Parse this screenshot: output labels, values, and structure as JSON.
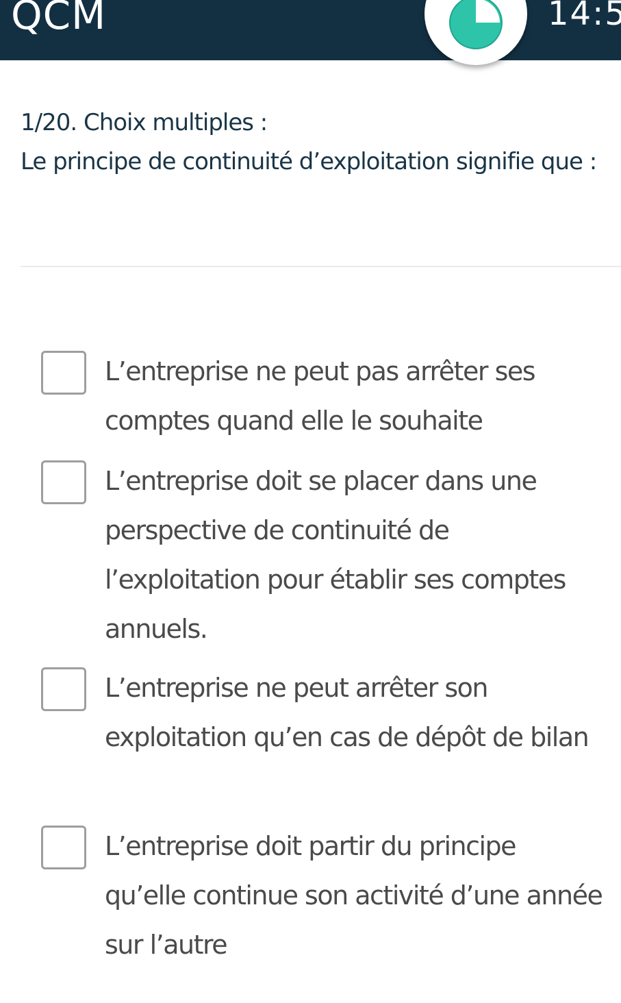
{
  "header": {
    "title": "QCM",
    "time": "14:5",
    "background_color": "#133043",
    "timer_icon": "clock-pie-icon",
    "timer_color": "#2ec4a9"
  },
  "question": {
    "number_label": "1/20. Choix multiples :",
    "text": "Le principe de continuité d’exploitation signifie que :"
  },
  "answers": [
    {
      "text": "L’entreprise ne peut pas arrêter ses comptes quand elle le souhaite",
      "checked": false
    },
    {
      "text": "L’entreprise doit se placer dans une perspective de continuité de l’exploitation pour établir ses comptes annuels.",
      "checked": false
    },
    {
      "text": "L’entreprise ne peut arrêter son exploitation qu’en cas de dépôt de bilan",
      "checked": false
    },
    {
      "text": "L’entreprise doit partir du principe qu’elle continue son activité d’une année sur l’autre",
      "checked": false
    }
  ]
}
